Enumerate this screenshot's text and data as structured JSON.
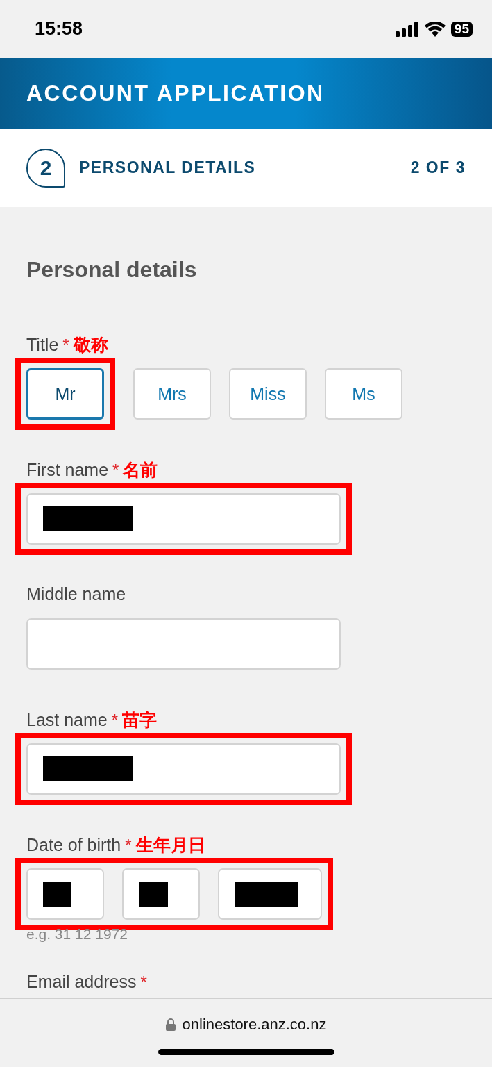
{
  "status_bar": {
    "time": "15:58",
    "battery": "95"
  },
  "header": {
    "title": "ACCOUNT APPLICATION"
  },
  "step": {
    "number": "2",
    "title": "PERSONAL DETAILS",
    "progress": "2 OF 3"
  },
  "section_title": "Personal details",
  "fields": [
    {
      "kind": "choice",
      "label": "Title",
      "asterisk": "*",
      "note": "敬称",
      "options": [
        {
          "label": "Mr",
          "selected": true,
          "highlighted": true
        },
        {
          "label": "Mrs",
          "selected": false,
          "highlighted": false
        },
        {
          "label": "Miss",
          "selected": false,
          "highlighted": false
        },
        {
          "label": "Ms",
          "selected": false,
          "highlighted": false
        }
      ]
    },
    {
      "kind": "text",
      "label": "First name",
      "asterisk": "*",
      "note": "名前",
      "highlighted": true,
      "redacted": true
    },
    {
      "kind": "text",
      "label": "Middle name",
      "highlighted": false,
      "redacted": false
    },
    {
      "kind": "text",
      "label": "Last name",
      "asterisk": "*",
      "note": "苗字",
      "highlighted": true,
      "redacted": true
    },
    {
      "kind": "date",
      "label": "Date of birth",
      "asterisk": "*",
      "note": "生年月日",
      "highlighted": true,
      "parts": [
        {
          "redacted": true
        },
        {
          "redacted": true
        },
        {
          "redacted": true
        }
      ],
      "hint": "e.g. 31 12 1972"
    },
    {
      "kind": "label",
      "label": "Email address",
      "asterisk": "*"
    }
  ],
  "browser_bar": {
    "url": "onlinestore.anz.co.nz"
  }
}
